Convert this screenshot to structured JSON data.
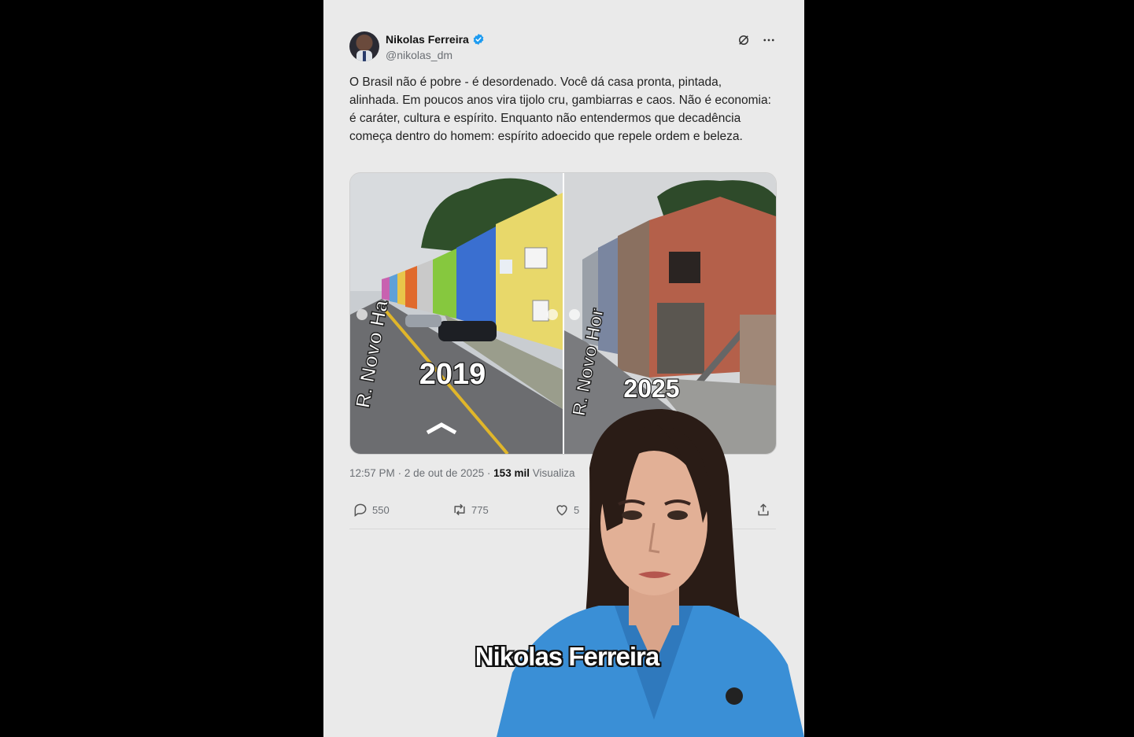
{
  "tweet": {
    "author_name": "Nikolas Ferreira",
    "author_handle": "@nikolas_dm",
    "text": "O Brasil não é pobre - é desordenado. Você dá casa pronta, pintada, alinhada. Em poucos anos vira tijolo cru, gambiarras e caos. Não é economia: é caráter, cultura e espírito. Enquanto não entendermos que decadência começa dentro do homem: espírito adoecido que repele ordem e beleza.",
    "time": "12:57 PM",
    "date": "2 de out de 2025",
    "views_count": "153 mil",
    "views_label": "Visualiza",
    "replies": "550",
    "reposts": "775",
    "likes": "5",
    "media": {
      "left_year": "2019",
      "right_year": "2025",
      "left_street": "R. Novo Ha",
      "right_street": "R. Novo Hor"
    }
  },
  "icons": [
    "verified-badge-icon",
    "grok-icon",
    "more-icon",
    "reply-icon",
    "repost-icon",
    "like-icon",
    "share-icon"
  ],
  "caption": "Nikolas Ferreira",
  "colors": {
    "panel_bg": "#eaeaea",
    "verified": "#1d9bf0",
    "muted_text": "#6b6f74",
    "blazer": "#3a8fd6"
  }
}
